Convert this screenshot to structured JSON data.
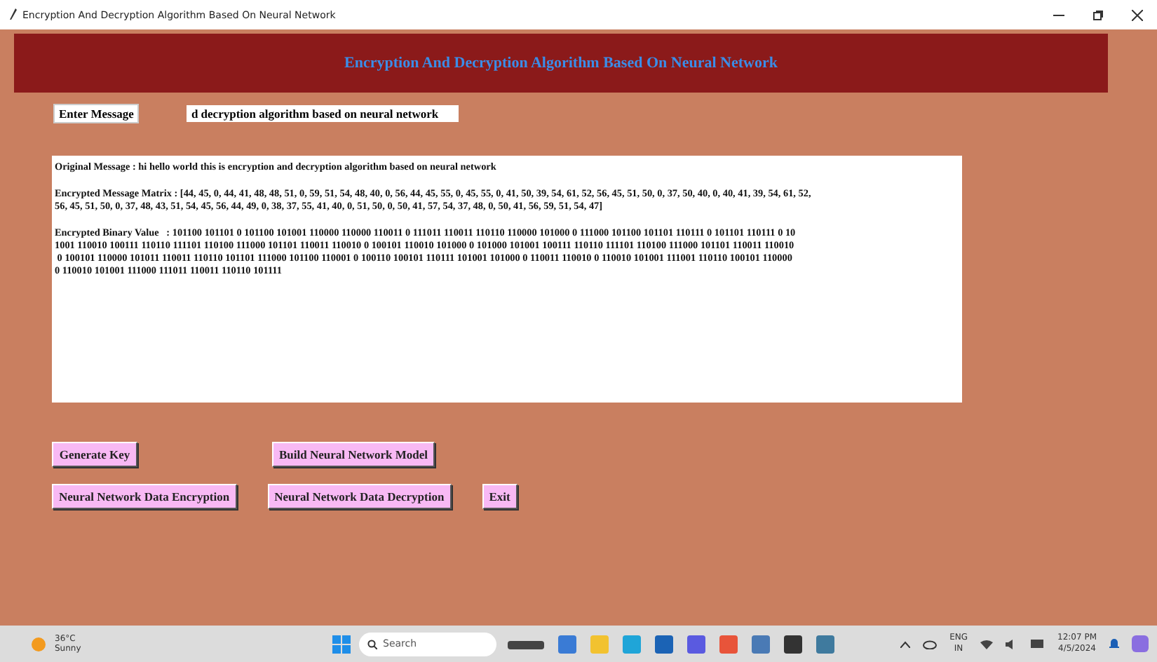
{
  "window": {
    "title": "Encryption And Decryption Algorithm Based On Neural Network"
  },
  "header": {
    "title": "Encryption And Decryption Algorithm Based On Neural Network"
  },
  "message_form": {
    "label": "Enter Message",
    "value": "d decryption algorithm based on neural network"
  },
  "output": [
    {
      "label": "Original Message : ",
      "lines": [
        "hi hello world this is encryption and decryption algorithm based on neural network"
      ]
    },
    {
      "label": "Encrypted Message Matrix : ",
      "lines": [
        "[44, 45, 0, 44, 41, 48, 48, 51, 0, 59, 51, 54, 48, 40, 0, 56, 44, 45, 55, 0, 45, 55, 0, 41, 50, 39, 54, 61, 52, 56, 45, 51, 50, 0, 37, 50, 40, 0, 40, 41, 39, 54, 61, 52,",
        "56, 45, 51, 50, 0, 37, 48, 43, 51, 54, 45, 56, 44, 49, 0, 38, 37, 55, 41, 40, 0, 51, 50, 0, 50, 41, 57, 54, 37, 48, 0, 50, 41, 56, 59, 51, 54, 47]"
      ]
    },
    {
      "label": "Encrypted Binary Value   : ",
      "lines": [
        "101100 101101 0 101100 101001 110000 110000 110011 0 111011 110011 110110 110000 101000 0 111000 101100 101101 110111 0 101101 110111 0 10",
        "1001 110010 100111 110110 111101 110100 111000 101101 110011 110010 0 100101 110010 101000 0 101000 101001 100111 110110 111101 110100 111000 101101 110011 110010",
        " 0 100101 110000 101011 110011 110110 101101 111000 101100 110001 0 100110 100101 110111 101001 101000 0 110011 110010 0 110010 101001 111001 110110 100101 110000",
        "0 110010 101001 111000 111011 110011 110110 101111"
      ]
    }
  ],
  "buttons": [
    [
      "Generate Key",
      "Build Neural Network Model"
    ],
    [
      "Neural Network Data Encryption",
      "Neural Network Data Decryption",
      "Exit"
    ]
  ],
  "taskbar": {
    "weather": {
      "temperature": "36°C",
      "condition": "Sunny"
    },
    "search": {
      "placeholder": "Search"
    },
    "language": {
      "code": "ENG",
      "region": "IN"
    },
    "time": "12:07 PM",
    "date": "4/5/2024"
  }
}
